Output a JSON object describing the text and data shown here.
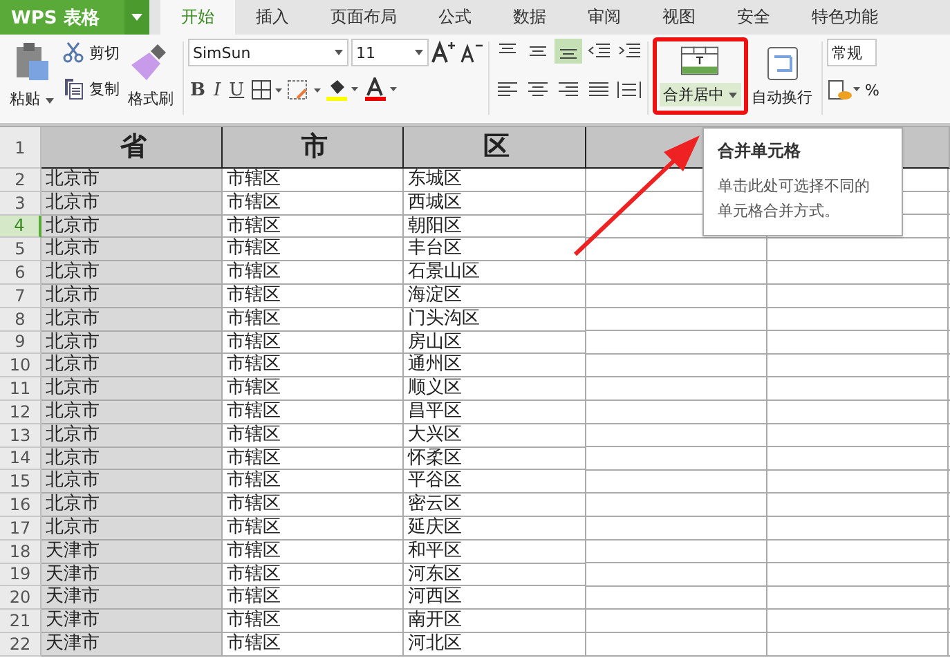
{
  "app": {
    "logo": "WPS 表格"
  },
  "tabs": [
    {
      "label": "开始",
      "selected": true
    },
    {
      "label": "插入",
      "selected": false
    },
    {
      "label": "页面布局",
      "selected": false
    },
    {
      "label": "公式",
      "selected": false
    },
    {
      "label": "数据",
      "selected": false
    },
    {
      "label": "审阅",
      "selected": false
    },
    {
      "label": "视图",
      "selected": false
    },
    {
      "label": "安全",
      "selected": false
    },
    {
      "label": "特色功能",
      "selected": false
    }
  ],
  "ribbon": {
    "paste": "粘贴",
    "cut": "剪切",
    "copy": "复制",
    "format_painter": "格式刷",
    "font_name": "SimSun",
    "font_size": "11",
    "bold": "B",
    "italic": "I",
    "underline": "U",
    "merge": {
      "label": "合并居中",
      "highlighted": true
    },
    "wrap": "自动换行",
    "number_format": "常规",
    "percent": "%"
  },
  "tooltip": {
    "title": "合并单元格",
    "text": "单击此处可选择不同的单元格合并方式。"
  },
  "sheet": {
    "columns": [
      {
        "selected": true
      },
      {
        "selected": false
      },
      {
        "selected": false
      },
      {
        "selected": false
      },
      {
        "selected": false
      }
    ],
    "header": {
      "number": "1",
      "cells": [
        "省",
        "市",
        "区"
      ]
    },
    "rows": [
      {
        "number": "2",
        "selected": false,
        "cells": [
          "北京市",
          "市辖区",
          "东城区"
        ]
      },
      {
        "number": "3",
        "selected": false,
        "cells": [
          "北京市",
          "市辖区",
          "西城区"
        ]
      },
      {
        "number": "4",
        "selected": true,
        "cells": [
          "北京市",
          "市辖区",
          "朝阳区"
        ]
      },
      {
        "number": "5",
        "selected": false,
        "cells": [
          "北京市",
          "市辖区",
          "丰台区"
        ]
      },
      {
        "number": "6",
        "selected": false,
        "cells": [
          "北京市",
          "市辖区",
          "石景山区"
        ]
      },
      {
        "number": "7",
        "selected": false,
        "cells": [
          "北京市",
          "市辖区",
          "海淀区"
        ]
      },
      {
        "number": "8",
        "selected": false,
        "cells": [
          "北京市",
          "市辖区",
          "门头沟区"
        ]
      },
      {
        "number": "9",
        "selected": false,
        "cells": [
          "北京市",
          "市辖区",
          "房山区"
        ]
      },
      {
        "number": "10",
        "selected": false,
        "cells": [
          "北京市",
          "市辖区",
          "通州区"
        ]
      },
      {
        "number": "11",
        "selected": false,
        "cells": [
          "北京市",
          "市辖区",
          "顺义区"
        ]
      },
      {
        "number": "12",
        "selected": false,
        "cells": [
          "北京市",
          "市辖区",
          "昌平区"
        ]
      },
      {
        "number": "13",
        "selected": false,
        "cells": [
          "北京市",
          "市辖区",
          "大兴区"
        ]
      },
      {
        "number": "14",
        "selected": false,
        "cells": [
          "北京市",
          "市辖区",
          "怀柔区"
        ]
      },
      {
        "number": "15",
        "selected": false,
        "cells": [
          "北京市",
          "市辖区",
          "平谷区"
        ]
      },
      {
        "number": "16",
        "selected": false,
        "cells": [
          "北京市",
          "市辖区",
          "密云区"
        ]
      },
      {
        "number": "17",
        "selected": false,
        "cells": [
          "北京市",
          "市辖区",
          "延庆区"
        ]
      },
      {
        "number": "18",
        "selected": false,
        "cells": [
          "天津市",
          "市辖区",
          "和平区"
        ]
      },
      {
        "number": "19",
        "selected": false,
        "cells": [
          "天津市",
          "市辖区",
          "河东区"
        ]
      },
      {
        "number": "20",
        "selected": false,
        "cells": [
          "天津市",
          "市辖区",
          "河西区"
        ]
      },
      {
        "number": "21",
        "selected": false,
        "cells": [
          "天津市",
          "市辖区",
          "南开区"
        ]
      },
      {
        "number": "22",
        "selected": false,
        "cells": [
          "天津市",
          "市辖区",
          "河北区"
        ]
      }
    ]
  }
}
